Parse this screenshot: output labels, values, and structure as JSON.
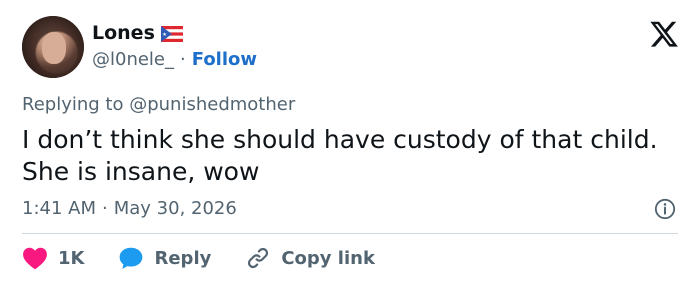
{
  "author": {
    "display_name": "Lones",
    "handle": "@l0nele_",
    "separator": "·",
    "follow_label": "Follow",
    "flag": "puerto-rico-flag-icon"
  },
  "tweet": {
    "replying_prefix": "Replying to",
    "replying_to": "@punishedmother",
    "text_line1": "I don’t think she should have custody of that child.",
    "text_line2": "She is insane, wow",
    "time": "1:41 AM",
    "meta_separator": "·",
    "date": "May 30, 2026"
  },
  "actions": {
    "like_count": "1K",
    "reply_label": "Reply",
    "copy_link_label": "Copy link"
  },
  "colors": {
    "accent": "#1d6fc9",
    "like": "#f91880",
    "reply": "#1d9bf0",
    "muted": "#536471"
  }
}
